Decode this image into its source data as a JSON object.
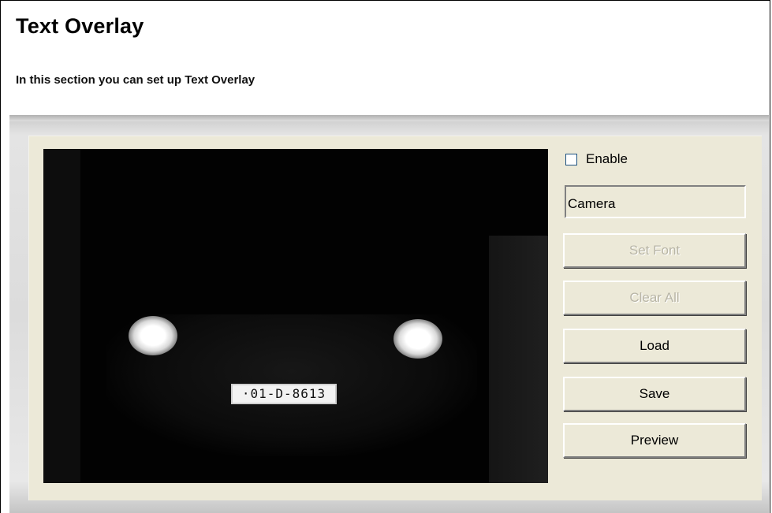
{
  "header": {
    "title": "Text Overlay",
    "subtitle": "In this section you can set up Text Overlay"
  },
  "preview": {
    "plate_text": "·01-D-8613"
  },
  "controls": {
    "enable_label": "Enable",
    "enable_checked": false,
    "overlay_text": "Camera",
    "set_font_label": "Set Font",
    "clear_all_label": "Clear All",
    "load_label": "Load",
    "save_label": "Save",
    "preview_label": "Preview"
  },
  "colors": {
    "panel_background": "#ece9d8",
    "disabled_text": "#b8b5a6"
  }
}
